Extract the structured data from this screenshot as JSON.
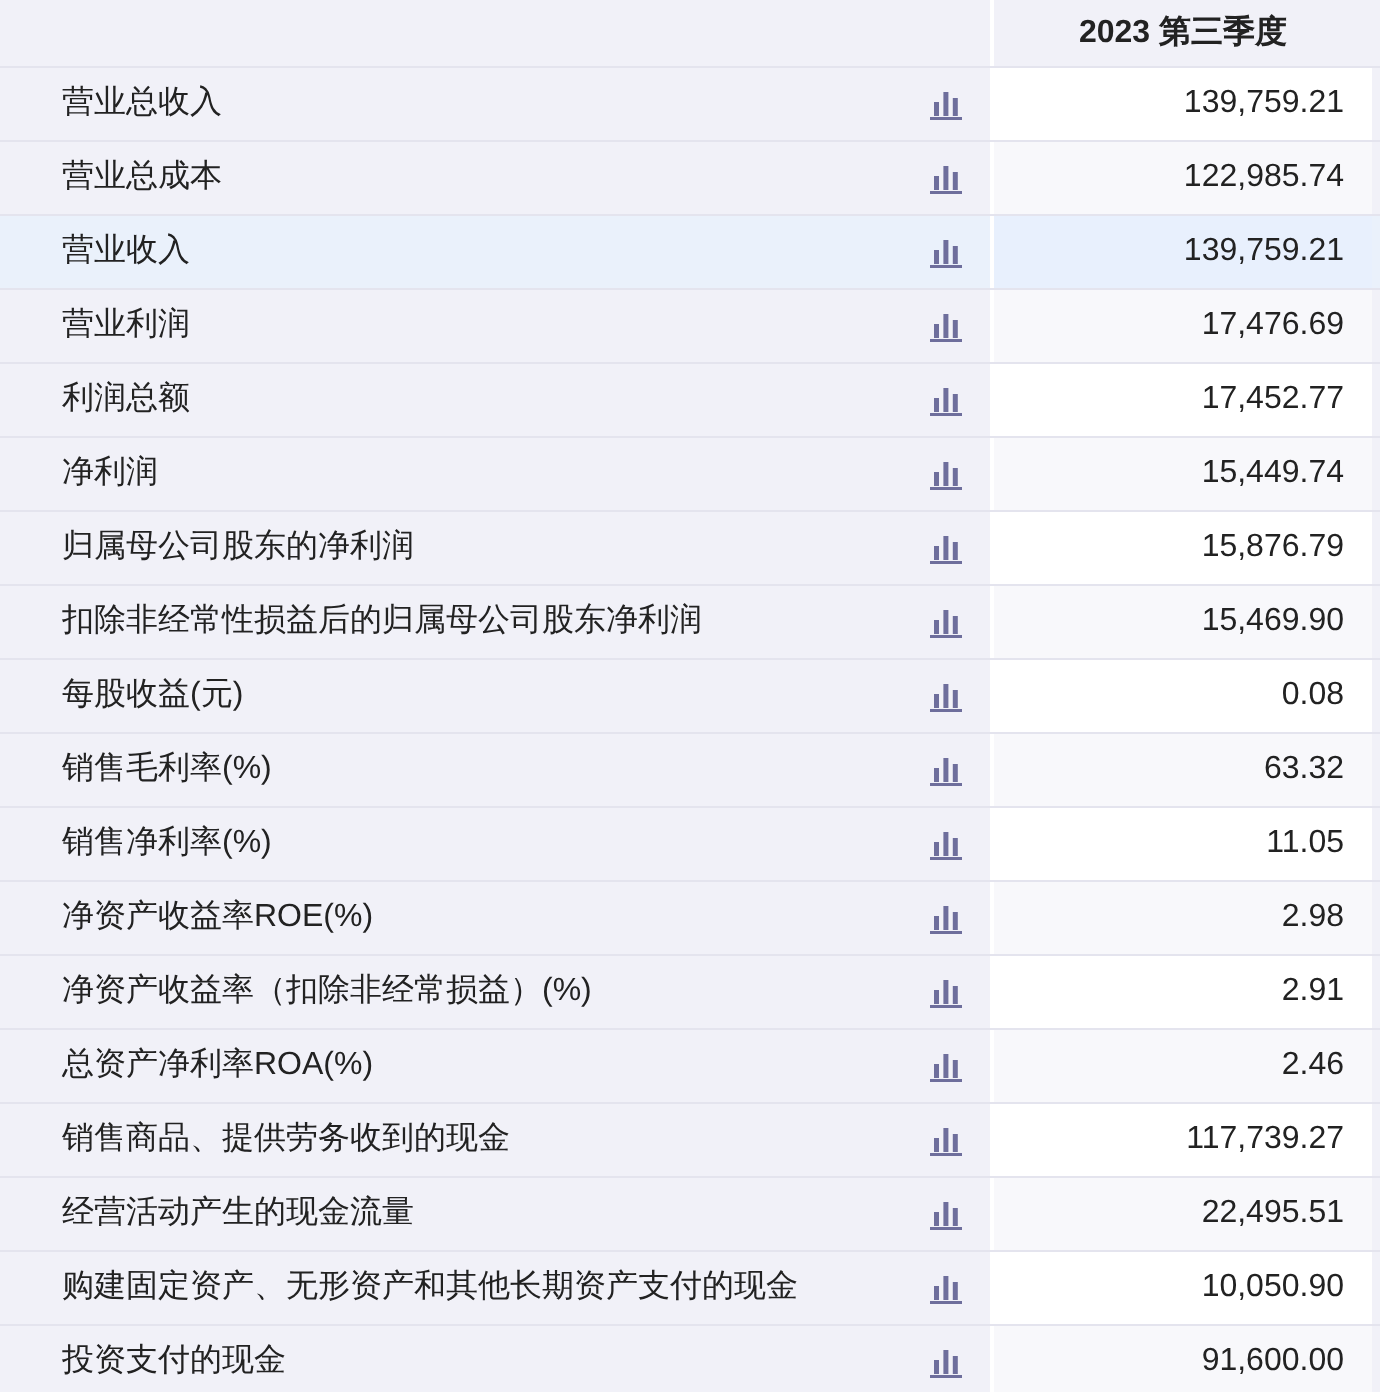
{
  "table": {
    "columns": [
      "2023 第三季度"
    ],
    "rows": [
      {
        "label": "营业总收入",
        "value": "139,759.21",
        "selected": false
      },
      {
        "label": "营业总成本",
        "value": "122,985.74",
        "selected": false
      },
      {
        "label": "营业收入",
        "value": "139,759.21",
        "selected": true
      },
      {
        "label": "营业利润",
        "value": "17,476.69",
        "selected": false
      },
      {
        "label": "利润总额",
        "value": "17,452.77",
        "selected": false
      },
      {
        "label": "净利润",
        "value": "15,449.74",
        "selected": false
      },
      {
        "label": "归属母公司股东的净利润",
        "value": "15,876.79",
        "selected": false
      },
      {
        "label": "扣除非经常性损益后的归属母公司股东净利润",
        "value": "15,469.90",
        "selected": false
      },
      {
        "label": "每股收益(元)",
        "value": "0.08",
        "selected": false
      },
      {
        "label": "销售毛利率(%)",
        "value": "63.32",
        "selected": false
      },
      {
        "label": "销售净利率(%)",
        "value": "11.05",
        "selected": false
      },
      {
        "label": "净资产收益率ROE(%)",
        "value": "2.98",
        "selected": false
      },
      {
        "label": "净资产收益率（扣除非经常损益）(%)",
        "value": "2.91",
        "selected": false
      },
      {
        "label": "总资产净利率ROA(%)",
        "value": "2.46",
        "selected": false
      },
      {
        "label": "销售商品、提供劳务收到的现金",
        "value": "117,739.27",
        "selected": false
      },
      {
        "label": "经营活动产生的现金流量",
        "value": "22,495.51",
        "selected": false
      },
      {
        "label": "购建固定资产、无形资产和其他长期资产支付的现金",
        "value": "10,050.90",
        "selected": false
      },
      {
        "label": "投资支付的现金",
        "value": "91,600.00",
        "selected": false
      }
    ]
  }
}
